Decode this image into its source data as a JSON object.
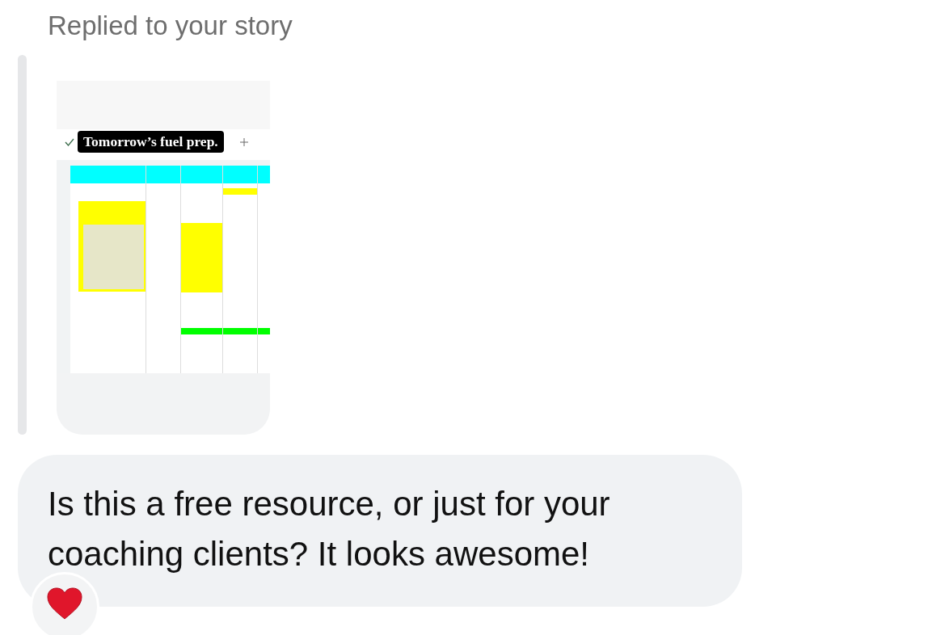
{
  "header": {
    "text": "Replied to your story"
  },
  "story": {
    "kind": "picture",
    "label": "Tomorrow’s fuel prep."
  },
  "message": {
    "text": "Is this a free resource, or just for your coaching clients? It looks awesome!",
    "reacted": true
  }
}
